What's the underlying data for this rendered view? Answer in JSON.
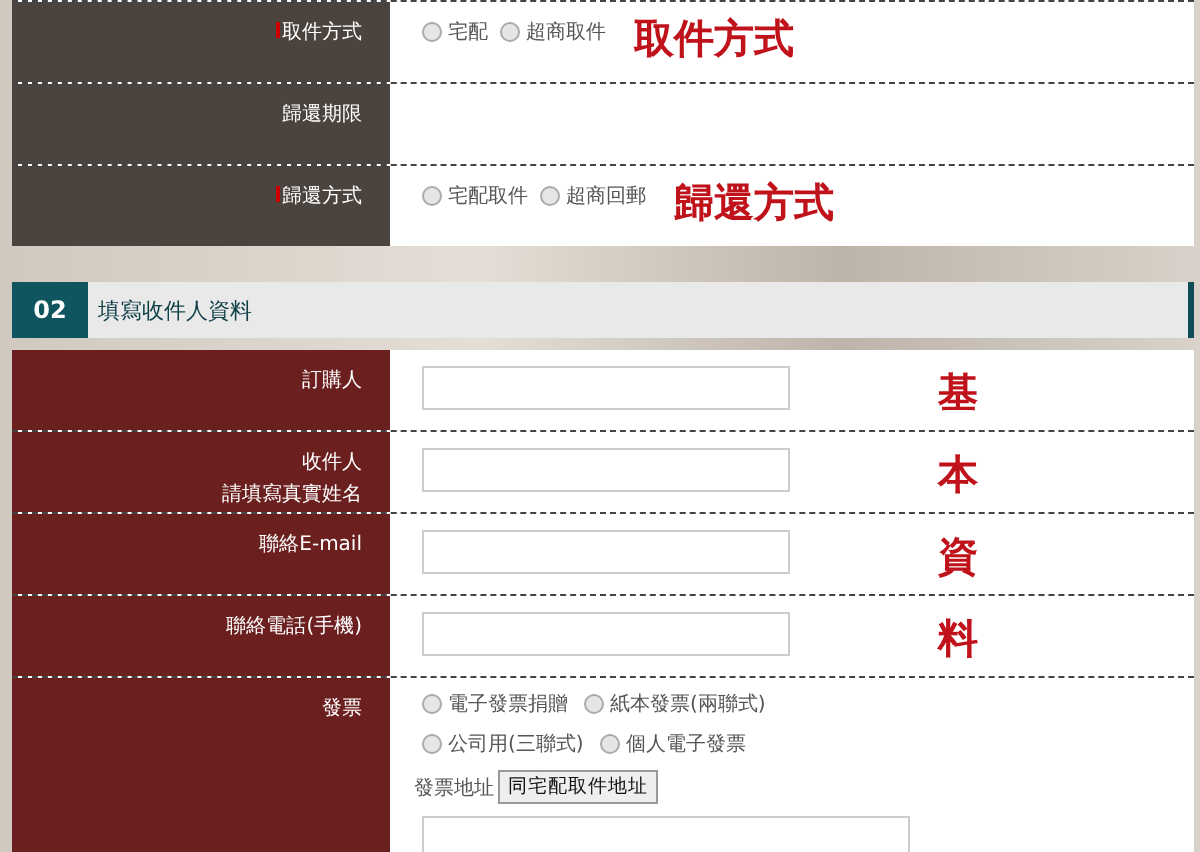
{
  "pickup_section": {
    "rows": [
      {
        "label": "取件方式",
        "required": true,
        "options": [
          {
            "label": "宅配",
            "selected": false
          },
          {
            "label": "超商取件",
            "selected": false
          }
        ],
        "annotation": "取件方式"
      },
      {
        "label": "歸還期限",
        "required": false,
        "options": []
      },
      {
        "label": "歸還方式",
        "required": true,
        "options": [
          {
            "label": "宅配取件",
            "selected": false
          },
          {
            "label": "超商回郵",
            "selected": false
          }
        ],
        "annotation": "歸還方式"
      }
    ]
  },
  "recipient_section": {
    "number": "02",
    "title": "填寫收件人資料",
    "fields": [
      {
        "label": "訂購人",
        "annotation": "基"
      },
      {
        "label": "收件人",
        "sublabel": "請填寫真實姓名",
        "annotation": "本"
      },
      {
        "label": "聯絡E-mail",
        "annotation": "資"
      },
      {
        "label": "聯絡電話(手機)",
        "annotation": "料"
      }
    ],
    "invoice": {
      "label": "發票",
      "options": [
        {
          "label": "電子發票捐贈",
          "selected": false
        },
        {
          "label": "紙本發票(兩聯式)",
          "selected": false
        },
        {
          "label": "公司用(三聯式)",
          "selected": false
        },
        {
          "label": "個人電子發票",
          "selected": false
        }
      ],
      "address_label": "發票地址",
      "copy_button": "同宅配取件地址"
    }
  }
}
